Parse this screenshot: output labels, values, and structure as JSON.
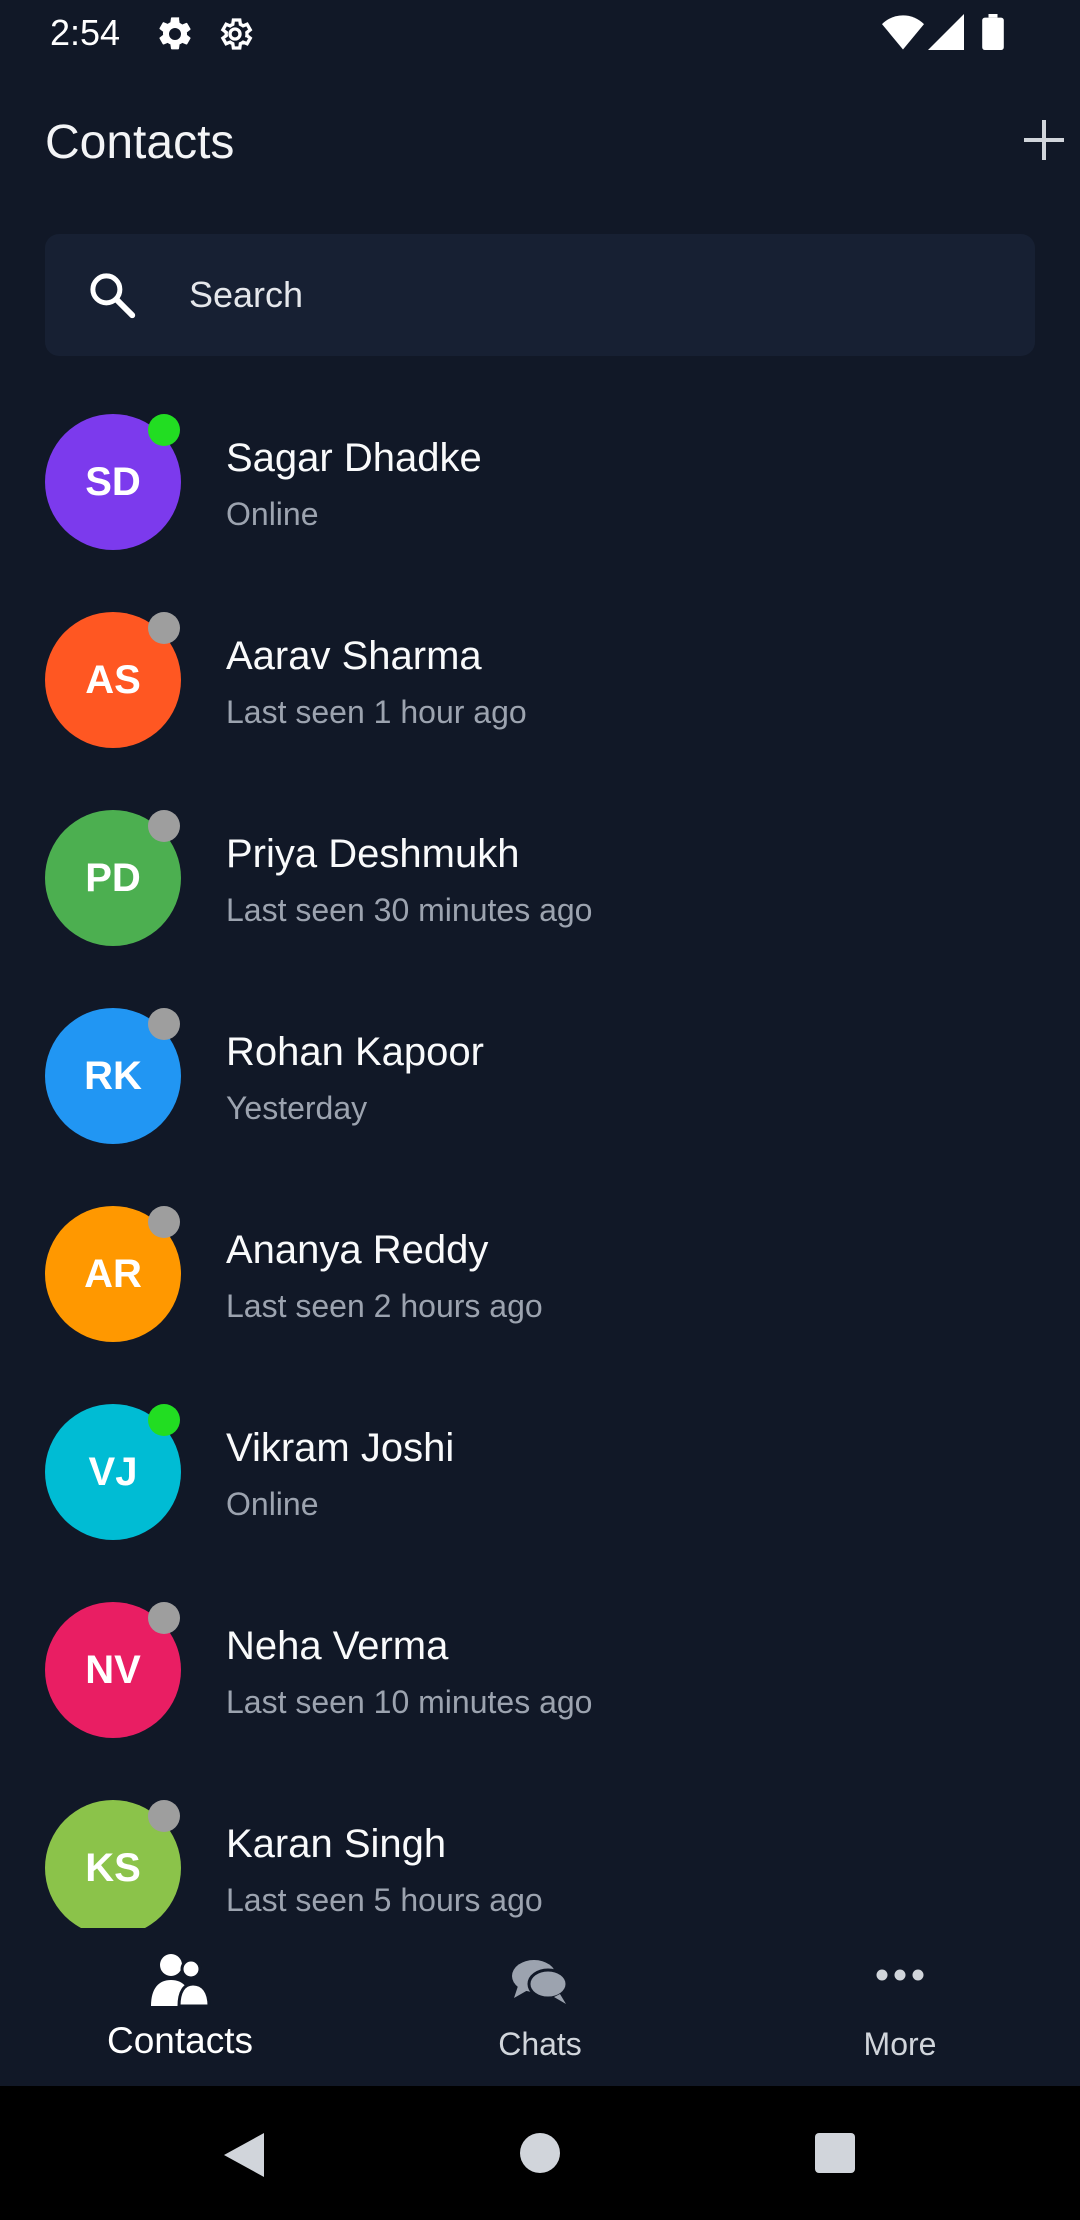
{
  "status_bar": {
    "time": "2:54"
  },
  "header": {
    "title": "Contacts"
  },
  "search": {
    "placeholder": "Search"
  },
  "contacts": [
    {
      "initials": "SD",
      "name": "Sagar Dhadke",
      "status": "Online",
      "avatar_color": "#7c3aed",
      "presence_color": "#22dd22"
    },
    {
      "initials": "AS",
      "name": "Aarav Sharma",
      "status": "Last seen 1 hour ago",
      "avatar_color": "#ff5722",
      "presence_color": "#9e9e9e"
    },
    {
      "initials": "PD",
      "name": "Priya Deshmukh",
      "status": "Last seen 30 minutes ago",
      "avatar_color": "#4caf50",
      "presence_color": "#9e9e9e"
    },
    {
      "initials": "RK",
      "name": "Rohan Kapoor",
      "status": "Yesterday",
      "avatar_color": "#2196f3",
      "presence_color": "#9e9e9e"
    },
    {
      "initials": "AR",
      "name": "Ananya Reddy",
      "status": "Last seen 2 hours ago",
      "avatar_color": "#ff9800",
      "presence_color": "#9e9e9e"
    },
    {
      "initials": "VJ",
      "name": "Vikram Joshi",
      "status": "Online",
      "avatar_color": "#00bcd4",
      "presence_color": "#22dd22"
    },
    {
      "initials": "NV",
      "name": "Neha Verma",
      "status": "Last seen 10 minutes ago",
      "avatar_color": "#e91e63",
      "presence_color": "#9e9e9e"
    },
    {
      "initials": "KS",
      "name": "Karan Singh",
      "status": "Last seen 5 hours ago",
      "avatar_color": "#8bc34a",
      "presence_color": "#9e9e9e"
    }
  ],
  "bottom_nav": [
    {
      "label": "Contacts",
      "icon": "contacts-icon",
      "active": true
    },
    {
      "label": "Chats",
      "icon": "chat-bubbles-icon",
      "active": false
    },
    {
      "label": "More",
      "icon": "more-dots-icon",
      "active": false
    }
  ],
  "colors": {
    "background": "#111827",
    "search_background": "#172033",
    "secondary_text": "#9ca3af",
    "online": "#22dd22",
    "offline": "#9e9e9e"
  }
}
